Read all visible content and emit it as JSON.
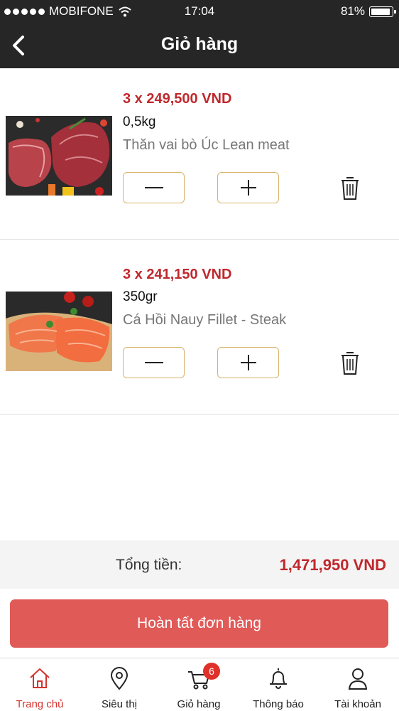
{
  "status_bar": {
    "carrier": "MOBIFONE",
    "time": "17:04",
    "battery": "81%"
  },
  "nav": {
    "title": "Giỏ hàng"
  },
  "cart_items": [
    {
      "price": "3 x 249,500 VND",
      "weight": "0,5kg",
      "name": "Thăn vai bò Úc Lean meat"
    },
    {
      "price": "3 x 241,150 VND",
      "weight": "350gr",
      "name": "Cá Hồi Nauy Fillet - Steak"
    }
  ],
  "summary": {
    "total_label": "Tổng tiền:",
    "total_value": "1,471,950 VND"
  },
  "checkout": {
    "label": "Hoàn tất đơn hàng"
  },
  "tabs": [
    {
      "label": "Trang chủ",
      "icon": "home-icon",
      "active": true
    },
    {
      "label": "Siêu thị",
      "icon": "location-pin-icon"
    },
    {
      "label": "Giỏ hàng",
      "icon": "cart-icon",
      "badge": "6"
    },
    {
      "label": "Thông báo",
      "icon": "bell-icon"
    },
    {
      "label": "Tài khoản",
      "icon": "user-icon"
    }
  ],
  "colors": {
    "accent": "#c0282d",
    "button": "#e05a58",
    "border": "#d8b36a",
    "topbar": "#262626"
  }
}
